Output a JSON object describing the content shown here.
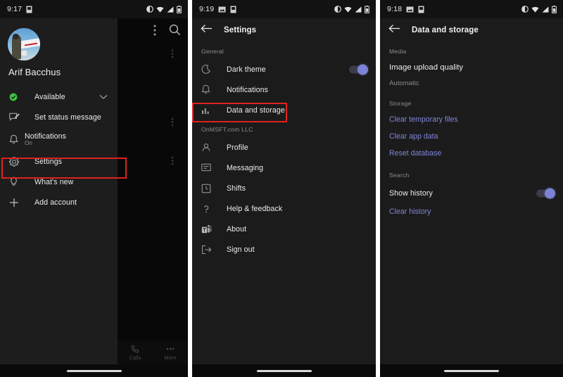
{
  "screens": {
    "drawer": {
      "status_bar": {
        "time": "9:17",
        "icons": [
          "sim-icon",
          "dnd-icon",
          "wifi-icon",
          "signal-icon",
          "battery-icon"
        ]
      },
      "top_actions": [
        "overflow-menu-icon",
        "search-icon"
      ],
      "profile": {
        "name": "Arif Bacchus",
        "avatar_alt": "user-avatar"
      },
      "items": [
        {
          "label": "Available",
          "icon": "presence-available-icon",
          "trailing": "chevron-down-icon"
        },
        {
          "label": "Set status message",
          "icon": "status-message-icon"
        },
        {
          "label": "Notifications",
          "sub": "On",
          "icon": "bell-icon"
        },
        {
          "label": "Settings",
          "icon": "gear-icon",
          "highlighted": true
        },
        {
          "label": "What's new",
          "icon": "lightbulb-icon"
        },
        {
          "label": "Add account",
          "icon": "plus-icon"
        }
      ],
      "bottom_nav": [
        {
          "label": "Calls",
          "icon": "phone-icon"
        },
        {
          "label": "More",
          "icon": "more-dots-icon"
        }
      ]
    },
    "settings": {
      "status_bar": {
        "time": "9:19",
        "icons": [
          "image-icon",
          "sim-icon",
          "dnd-icon",
          "wifi-icon",
          "signal-icon",
          "battery-icon"
        ]
      },
      "back": "back-arrow-icon",
      "title": "Settings",
      "sections": [
        {
          "label": "General",
          "items": [
            {
              "label": "Dark theme",
              "icon": "moon-icon",
              "toggle": true,
              "toggle_on": true
            },
            {
              "label": "Notifications",
              "icon": "bell-icon"
            },
            {
              "label": "Data and storage",
              "icon": "data-usage-icon",
              "highlighted": true
            }
          ]
        },
        {
          "label": "OnMSFT.com LLC",
          "items": [
            {
              "label": "Profile",
              "icon": "person-icon"
            },
            {
              "label": "Messaging",
              "icon": "message-icon"
            },
            {
              "label": "Shifts",
              "icon": "clock-icon"
            },
            {
              "label": "Help & feedback",
              "icon": "question-mark-icon"
            },
            {
              "label": "About",
              "icon": "teams-logo-icon"
            },
            {
              "label": "Sign out",
              "icon": "sign-out-icon"
            }
          ]
        }
      ]
    },
    "data_storage": {
      "status_bar": {
        "time": "9:18",
        "icons": [
          "image-icon",
          "sim-icon",
          "dnd-icon",
          "wifi-icon",
          "signal-icon",
          "battery-icon"
        ]
      },
      "back": "back-arrow-icon",
      "title": "Data and storage",
      "sections": [
        {
          "label": "Media",
          "setting_title": "Image upload quality",
          "setting_value": "Automatic"
        },
        {
          "label": "Storage",
          "links": [
            "Clear temporary files",
            "Clear app data",
            "Reset database"
          ]
        },
        {
          "label": "Search",
          "toggle_label": "Show history",
          "toggle_on": true,
          "links": [
            "Clear history"
          ]
        }
      ]
    }
  },
  "colors": {
    "accent": "#7c82d6",
    "link": "#8086d8",
    "highlight": "#e02121",
    "available": "#3ec13e",
    "background": "#1b1b1b"
  }
}
